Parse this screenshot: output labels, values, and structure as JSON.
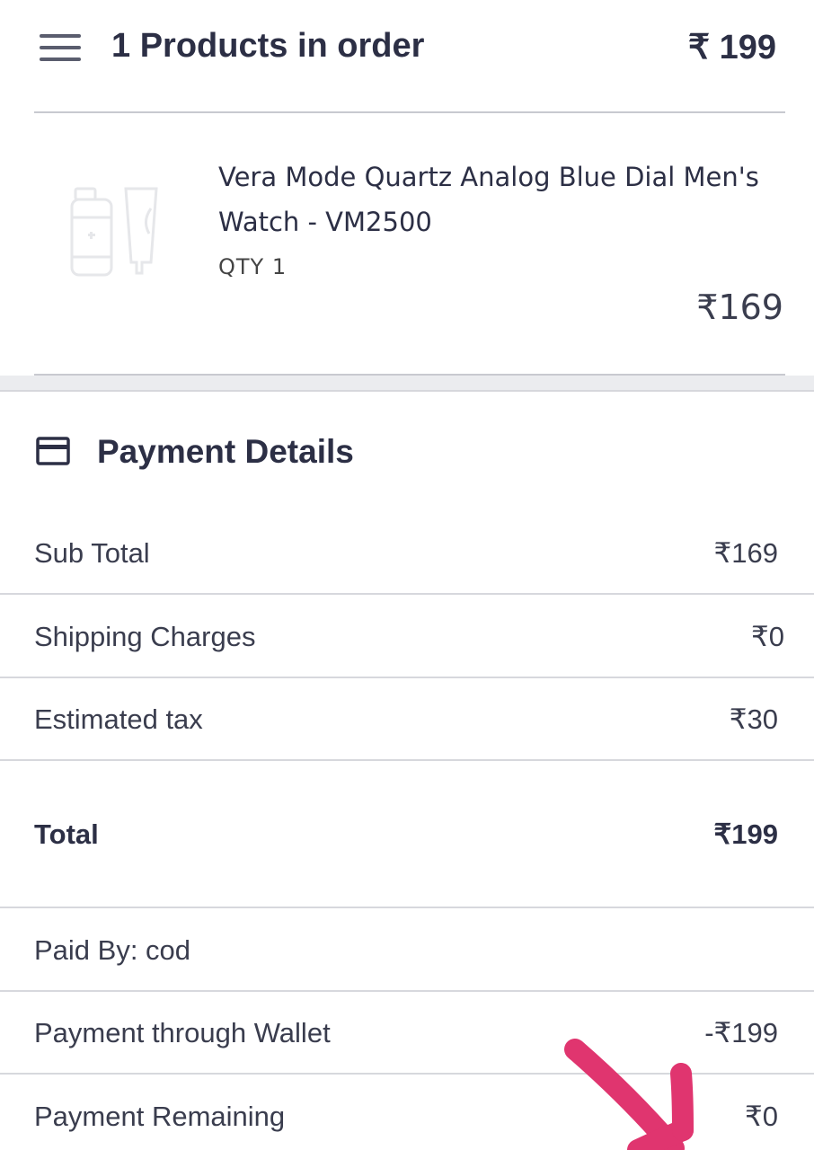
{
  "header": {
    "title": "1 Products in order",
    "amount": "₹ 199"
  },
  "product": {
    "name": "Vera Mode Quartz Analog Blue Dial Men's Watch - VM2500",
    "qty": "QTY 1",
    "price": "₹169"
  },
  "payment": {
    "title": "Payment Details",
    "rows": [
      {
        "label": "Sub Total",
        "value": "₹169"
      },
      {
        "label": "Shipping Charges",
        "value": "₹0"
      },
      {
        "label": "Estimated tax",
        "value": "₹30"
      },
      {
        "label": "Total",
        "value": "₹199"
      },
      {
        "label": "Paid By: cod",
        "value": ""
      },
      {
        "label": "Payment through Wallet",
        "value": "-₹199"
      },
      {
        "label": "Payment Remaining",
        "value": "₹0"
      }
    ]
  },
  "icons": {
    "menu": "hamburger-menu-icon",
    "product_placeholder": "product-placeholder-icon",
    "payment": "credit-card-icon",
    "annotation": "pink-arrow-annotation"
  },
  "colors": {
    "text": "#2c2f45",
    "divider": "#d7d8dd",
    "annotation": "#e0356f"
  }
}
